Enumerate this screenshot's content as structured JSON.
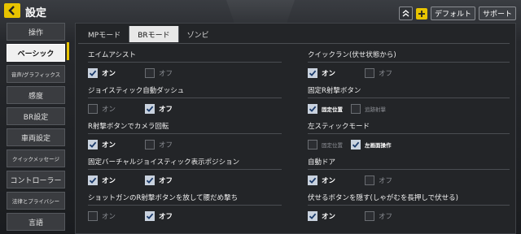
{
  "header": {
    "title": "設定",
    "default_label": "デフォルト",
    "support_label": "サポート"
  },
  "sidebar": {
    "items": [
      {
        "label": "操作",
        "active": false
      },
      {
        "label": "ベーシック",
        "active": true
      },
      {
        "label": "音声/グラフィックス",
        "active": false
      },
      {
        "label": "感度",
        "active": false
      },
      {
        "label": "BR設定",
        "active": false
      },
      {
        "label": "車両設定",
        "active": false
      },
      {
        "label": "クイックメッセージ",
        "active": false
      },
      {
        "label": "コントローラー",
        "active": false
      },
      {
        "label": "法律とプライバシー",
        "active": false
      },
      {
        "label": "言語",
        "active": false
      }
    ]
  },
  "tabs": [
    {
      "label": "MPモード",
      "active": false
    },
    {
      "label": "BRモード",
      "active": true
    },
    {
      "label": "ゾンビ",
      "active": false
    }
  ],
  "settings": {
    "left": [
      {
        "title": "エイムアシスト",
        "options": [
          {
            "label": "オン",
            "checked": true
          },
          {
            "label": "オフ",
            "checked": false
          }
        ]
      },
      {
        "title": "ジョイスティック自動ダッシュ",
        "options": [
          {
            "label": "オン",
            "checked": false
          },
          {
            "label": "オフ",
            "checked": true
          }
        ]
      },
      {
        "title": "R射撃ボタンでカメラ回転",
        "options": [
          {
            "label": "オン",
            "checked": true
          },
          {
            "label": "オフ",
            "checked": false
          }
        ]
      },
      {
        "title": "固定バーチャルジョイスティック表示ポジション",
        "options": [
          {
            "label": "オン",
            "checked": true
          },
          {
            "label": "オフ",
            "checked": true
          }
        ]
      },
      {
        "title": "ショットガンのR射撃ボタンを放して腰だめ撃ち",
        "options": [
          {
            "label": "オン",
            "checked": false
          },
          {
            "label": "オフ",
            "checked": true
          }
        ]
      }
    ],
    "right": [
      {
        "title": "クイックラン(伏せ状態から)",
        "options": [
          {
            "label": "オン",
            "checked": true
          },
          {
            "label": "オフ",
            "checked": false
          }
        ]
      },
      {
        "title": "固定R射撃ボタン",
        "options": [
          {
            "label": "固定位置",
            "checked": true
          },
          {
            "label": "追跡射撃",
            "checked": false
          }
        ]
      },
      {
        "title": "左スティックモード",
        "options": [
          {
            "label": "固定位置",
            "checked": false
          },
          {
            "label": "左画面操作",
            "checked": true
          }
        ]
      },
      {
        "title": "自動ドア",
        "options": [
          {
            "label": "オン",
            "checked": true
          },
          {
            "label": "オフ",
            "checked": false
          }
        ]
      },
      {
        "title": "伏せるボタンを隠す(しゃがむを長押しで伏せる)",
        "options": [
          {
            "label": "オン",
            "checked": true
          },
          {
            "label": "オフ",
            "checked": false
          }
        ]
      }
    ]
  }
}
